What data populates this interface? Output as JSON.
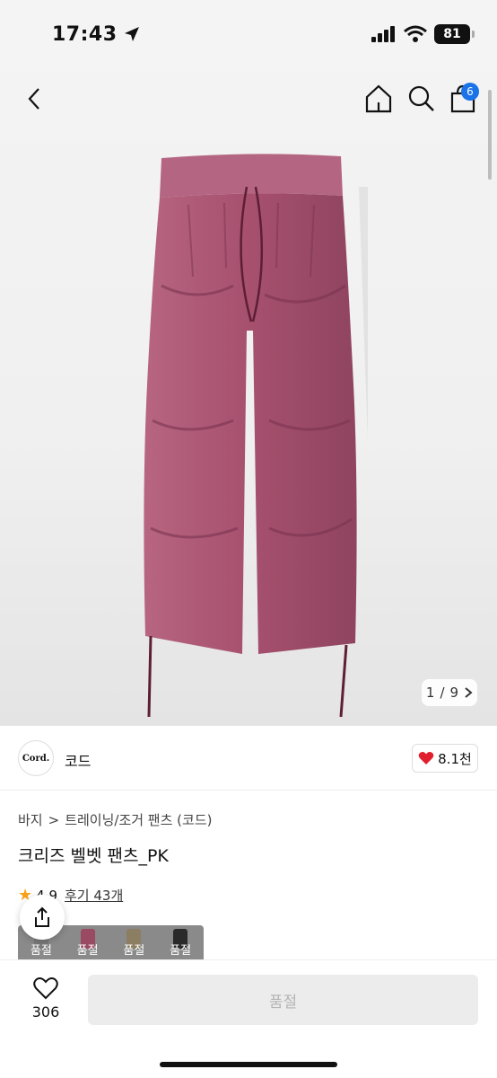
{
  "status": {
    "time": "17:43",
    "battery": "81"
  },
  "nav": {
    "cart_count": "6"
  },
  "gallery": {
    "current": "1",
    "separator": "/",
    "total": "9",
    "fabric_color": "#a6506e"
  },
  "brand": {
    "logo_text": "Cord.",
    "name": "코드",
    "likes": "8.1천"
  },
  "breadcrumb": {
    "root": "바지",
    "separator": ">",
    "category": "트레이닝/조거 팬츠 (코드)"
  },
  "product": {
    "title": "크리즈 벨벳 팬츠_PK",
    "rating": "4.9",
    "reviews": "후기 43개"
  },
  "swatches": [
    {
      "label": "품절",
      "color": "#7a7a7a"
    },
    {
      "label": "품절",
      "color": "#9a4a62"
    },
    {
      "label": "품절",
      "color": "#8c7e62"
    },
    {
      "label": "품절",
      "color": "#2a2a2a"
    }
  ],
  "bottom": {
    "wish_count": "306",
    "buy_label": "품절"
  },
  "colors": {
    "accent": "#1a73e8",
    "heart": "#e0202e",
    "star": "#f7a21a"
  }
}
